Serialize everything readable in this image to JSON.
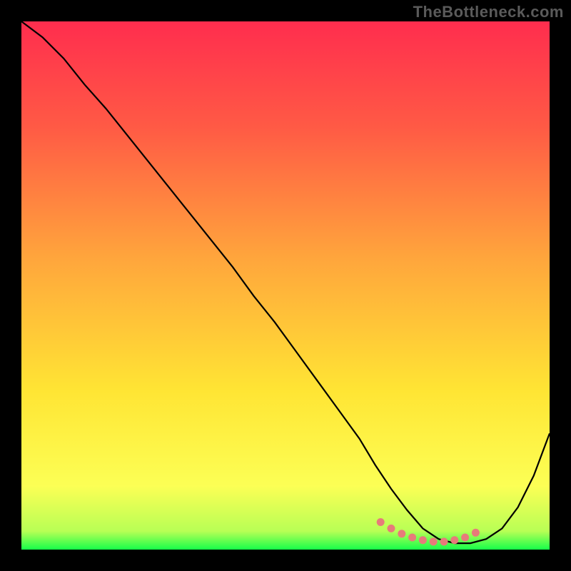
{
  "watermark": "TheBottleneck.com",
  "chart_data": {
    "type": "line",
    "title": "",
    "xlabel": "",
    "ylabel": "",
    "xlim": [
      0,
      100
    ],
    "ylim": [
      0,
      100
    ],
    "grid": false,
    "legend": false,
    "series": [
      {
        "name": "curve",
        "color": "#000000",
        "x": [
          0,
          4,
          8,
          12,
          16,
          20,
          24,
          28,
          32,
          36,
          40,
          44,
          48,
          52,
          56,
          60,
          64,
          67,
          70,
          73,
          76,
          79,
          82,
          85,
          88,
          91,
          94,
          97,
          100
        ],
        "y": [
          100,
          97,
          93,
          88,
          83.5,
          78.5,
          73.5,
          68.5,
          63.5,
          58.5,
          53.5,
          48,
          43,
          37.5,
          32,
          26.5,
          21,
          16,
          11.5,
          7.5,
          4,
          2,
          1.2,
          1.2,
          2,
          4,
          8,
          14,
          22
        ]
      },
      {
        "name": "green-band",
        "color": "#16ff4a",
        "x": [
          0,
          100
        ],
        "y": [
          2.5,
          2.5
        ]
      },
      {
        "name": "highlight-dots",
        "color": "#e77b7a",
        "type": "scatter",
        "x": [
          68,
          70,
          72,
          74,
          76,
          78,
          80,
          82,
          84,
          86
        ],
        "y": [
          5.2,
          4.0,
          3.0,
          2.3,
          1.8,
          1.5,
          1.5,
          1.8,
          2.3,
          3.2
        ]
      }
    ],
    "gradient_stops": [
      {
        "offset": 0.0,
        "color": "#ff2d4e"
      },
      {
        "offset": 0.2,
        "color": "#ff5a45"
      },
      {
        "offset": 0.45,
        "color": "#ffa63c"
      },
      {
        "offset": 0.7,
        "color": "#ffe534"
      },
      {
        "offset": 0.88,
        "color": "#fcff55"
      },
      {
        "offset": 0.965,
        "color": "#b8ff55"
      },
      {
        "offset": 1.0,
        "color": "#16ff4a"
      }
    ]
  }
}
